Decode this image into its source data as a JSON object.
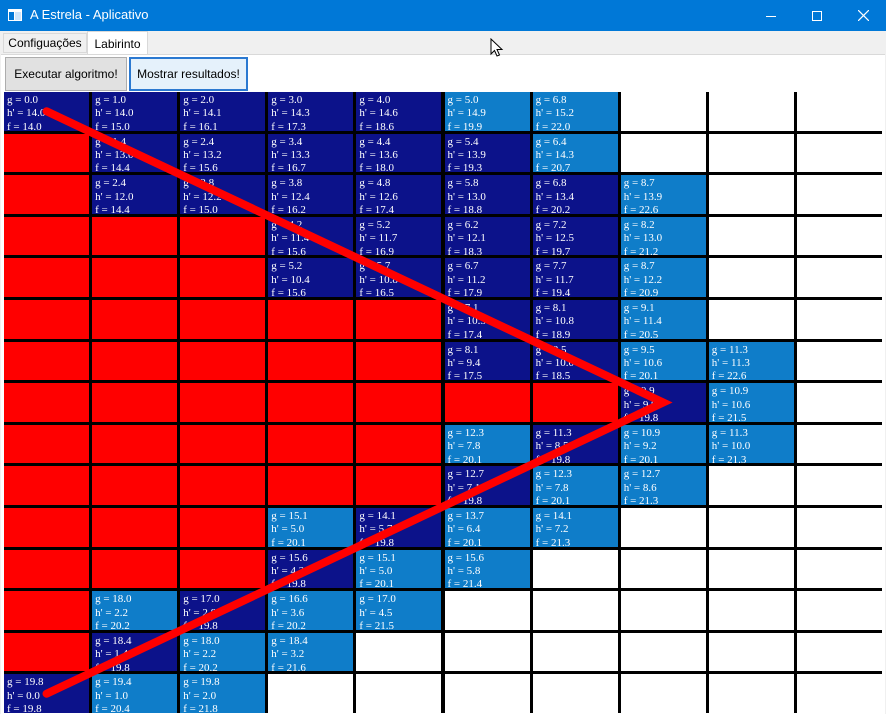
{
  "window": {
    "title": "A Estrela - Aplicativo",
    "minimize_icon": "minimize-icon",
    "maximize_icon": "maximize-icon",
    "close_icon": "close-icon"
  },
  "tabs": [
    {
      "label": "Configuações",
      "active": false
    },
    {
      "label": "Labirinto",
      "active": true
    }
  ],
  "toolbar": {
    "run_label": "Executar algoritmo!",
    "show_label": "Mostrar resultados!"
  },
  "grid": {
    "rows": 15,
    "cols": 10,
    "colors": {
      "wall": "#ff0000",
      "closed": "#0c128a",
      "open": "#0f7dc9",
      "empty": "#ffffff",
      "grid": "#000000",
      "path": "#ff0000"
    },
    "cells": [
      [
        "C|g = 0.0|h' = 14.0|f = 14.0",
        "C|g = 1.0|h' = 14.0|f = 15.0",
        "C|g = 2.0|h' = 14.1|f = 16.1",
        "C|g = 3.0|h' = 14.3|f = 17.3",
        "C|g = 4.0|h' = 14.6|f = 18.6",
        "O|g = 5.0|h' = 14.9|f = 19.9",
        "O|g = 6.8|h' = 15.2|f = 22.0",
        "E",
        "E",
        "E"
      ],
      [
        "W",
        "C|g = 1.4|h' = 13.0|f = 14.4",
        "C|g = 2.4|h' = 13.2|f = 15.6",
        "C|g = 3.4|h' = 13.3|f = 16.7",
        "C|g = 4.4|h' = 13.6|f = 18.0",
        "C|g = 5.4|h' = 13.9|f = 19.3",
        "O|g = 6.4|h' = 14.3|f = 20.7",
        "E",
        "E",
        "E"
      ],
      [
        "W",
        "C|g = 2.4|h' = 12.0|f = 14.4",
        "C|g = 2.8|h' = 12.2|f = 15.0",
        "C|g = 3.8|h' = 12.4|f = 16.2",
        "C|g = 4.8|h' = 12.6|f = 17.4",
        "C|g = 5.8|h' = 13.0|f = 18.8",
        "C|g = 6.8|h' = 13.4|f = 20.2",
        "O|g = 8.7|h' = 13.9|f = 22.6",
        "E",
        "E"
      ],
      [
        "W",
        "W",
        "W",
        "C|g = 4.2|h' = 11.4|f = 15.6",
        "C|g = 5.2|h' = 11.7|f = 16.9",
        "C|g = 6.2|h' = 12.1|f = 18.3",
        "C|g = 7.2|h' = 12.5|f = 19.7",
        "O|g = 8.2|h' = 13.0|f = 21.2",
        "E",
        "E"
      ],
      [
        "W",
        "W",
        "W",
        "C|g = 5.2|h' = 10.4|f = 15.6",
        "C|g = 5.7|h' = 10.8|f = 16.5",
        "C|g = 6.7|h' = 11.2|f = 17.9",
        "C|g = 7.7|h' = 11.7|f = 19.4",
        "O|g = 8.7|h' = 12.2|f = 20.9",
        "E",
        "E"
      ],
      [
        "W",
        "W",
        "W",
        "W",
        "W",
        "C|g = 7.1|h' = 10.3|f = 17.4",
        "C|g = 8.1|h' = 10.8|f = 18.9",
        "O|g = 9.1|h' = 11.4|f = 20.5",
        "E",
        "E"
      ],
      [
        "W",
        "W",
        "W",
        "W",
        "W",
        "C|g = 8.1|h' = 9.4|f = 17.5",
        "C|g = 8.5|h' = 10.0|f = 18.5",
        "O|g = 9.5|h' = 10.6|f = 20.1",
        "O|g = 11.3|h' = 11.3|f = 22.6",
        "E"
      ],
      [
        "W",
        "W",
        "W",
        "W",
        "W",
        "W",
        "W",
        "C|g = 9.9|h' = 9.9|f = 19.8",
        "O|g = 10.9|h' = 10.6|f = 21.5",
        "E"
      ],
      [
        "W",
        "W",
        "W",
        "W",
        "W",
        "O|g = 12.3|h' = 7.8|f = 20.1",
        "C|g = 11.3|h' = 8.5|f = 19.8",
        "O|g = 10.9|h' = 9.2|f = 20.1",
        "O|g = 11.3|h' = 10.0|f = 21.3",
        "E"
      ],
      [
        "W",
        "W",
        "W",
        "W",
        "W",
        "C|g = 12.7|h' = 7.1|f = 19.8",
        "O|g = 12.3|h' = 7.8|f = 20.1",
        "O|g = 12.7|h' = 8.6|f = 21.3",
        "E",
        "E"
      ],
      [
        "W",
        "W",
        "W",
        "O|g = 15.1|h' = 5.0|f = 20.1",
        "C|g = 14.1|h' = 5.7|f = 19.8",
        "O|g = 13.7|h' = 6.4|f = 20.1",
        "O|g = 14.1|h' = 7.2|f = 21.3",
        "E",
        "E",
        "E"
      ],
      [
        "W",
        "W",
        "W",
        "C|g = 15.6|h' = 4.2|f = 19.8",
        "O|g = 15.1|h' = 5.0|f = 20.1",
        "O|g = 15.6|h' = 5.8|f = 21.4",
        "E",
        "E",
        "E",
        "E"
      ],
      [
        "W",
        "O|g = 18.0|h' = 2.2|f = 20.2",
        "C|g = 17.0|h' = 2.8|f = 19.8",
        "O|g = 16.6|h' = 3.6|f = 20.2",
        "O|g = 17.0|h' = 4.5|f = 21.5",
        "E",
        "E",
        "E",
        "E",
        "E"
      ],
      [
        "W",
        "C|g = 18.4|h' = 1.4|f = 19.8",
        "O|g = 18.0|h' = 2.2|f = 20.2",
        "O|g = 18.4|h' = 3.2|f = 21.6",
        "E",
        "E",
        "E",
        "E",
        "E",
        "E"
      ],
      [
        "C|g = 19.8|h' = 0.0|f = 19.8",
        "O|g = 19.4|h' = 1.0|f = 20.4",
        "O|g = 19.8|h' = 2.0|f = 21.8",
        "E",
        "E",
        "E",
        "E",
        "E",
        "E",
        "E"
      ]
    ],
    "path": [
      [
        0,
        0
      ],
      [
        7,
        7
      ],
      [
        14,
        0
      ]
    ]
  }
}
